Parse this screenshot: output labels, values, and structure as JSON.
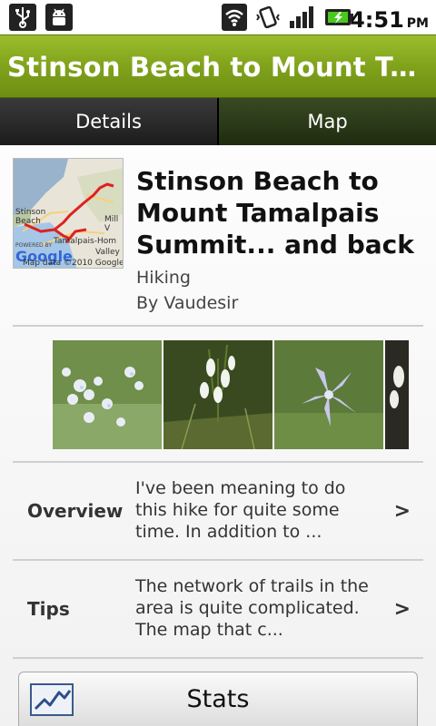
{
  "status_bar": {
    "time": "4:51",
    "ampm": "PM",
    "icons": [
      "usb-icon",
      "android-debug-icon",
      "wifi-icon",
      "vibrate-icon",
      "signal-icon",
      "battery-charging-icon"
    ]
  },
  "title_bar": {
    "title": "Stinson Beach to Mount Tamalpais Summit... and back"
  },
  "tabs": [
    {
      "label": "Details",
      "active": true
    },
    {
      "label": "Map",
      "active": false
    }
  ],
  "route": {
    "title": "Stinson Beach to Mount Tamalpais Summit... and back",
    "type": "Hiking",
    "author": "By Vaudesir"
  },
  "map_thumbnail": {
    "labels": [
      "Stinson Beach",
      "Mill V",
      "Tamalpais-Hom",
      "Valley"
    ],
    "attribution": "Map data ©2010 Google",
    "powered_by": "POWERED BY",
    "logo": "Google"
  },
  "photos": [
    {
      "name": "wildflower-photo-1"
    },
    {
      "name": "wildflower-photo-2"
    },
    {
      "name": "iris-photo"
    },
    {
      "name": "wildflower-photo-4"
    }
  ],
  "sections": [
    {
      "label": "Overview",
      "text": "I've been meaning to do this hike for quite some time. In addition to ...",
      "arrow": ">"
    },
    {
      "label": "Tips",
      "text": "The network of trails in the area is quite complicated. The map that c...",
      "arrow": ">"
    }
  ],
  "stats_button": {
    "label": "Stats",
    "icon": "chart-line-icon"
  },
  "colors": {
    "title_bar": "#7ea01a",
    "route_line": "#e02020"
  }
}
